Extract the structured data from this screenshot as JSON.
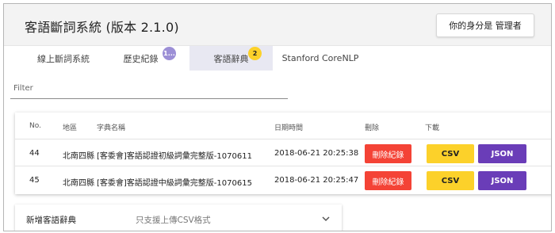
{
  "header": {
    "title": "客語斷詞系統 (版本 2.1.0)",
    "identity_label": "你的身分是 管理者"
  },
  "tabs": [
    {
      "label": "線上斷詞系統",
      "badge": ""
    },
    {
      "label": "歷史紀錄",
      "badge": "1..."
    },
    {
      "label": "客語辭典",
      "badge": "2"
    },
    {
      "label": "Stanford CoreNLP",
      "badge": ""
    }
  ],
  "filter": {
    "placeholder": "Filter",
    "value": ""
  },
  "table": {
    "headers": {
      "no": "No.",
      "region": "地區",
      "dict_name": "字典名稱",
      "datetime": "日期時間",
      "delete": "刪除",
      "download": "下載"
    },
    "rows": [
      {
        "no": "44",
        "region": "北南四縣",
        "dict_name": "[客委會]客語認證初級詞彙完整版-1070611",
        "datetime": "2018-06-21 20:25:38",
        "delete_label": "刪除紀錄",
        "csv_label": "CSV",
        "json_label": "JSON"
      },
      {
        "no": "45",
        "region": "北南四縣",
        "dict_name": "[客委會]客語認證中級詞彙完整版-1070615",
        "datetime": "2018-06-21 20:25:47",
        "delete_label": "刪除紀錄",
        "csv_label": "CSV",
        "json_label": "JSON"
      }
    ]
  },
  "add_dictionary": {
    "title": "新增客語辭典",
    "hint": "只支援上傳CSV格式",
    "icon": "chevron-down-icon"
  },
  "colors": {
    "active_tab_bg": "#e8e8f2",
    "badge_purple": "#9c8fd6",
    "badge_yellow": "#fcd12a",
    "delete_red": "#f44336",
    "csv_yellow": "#fcd12a",
    "json_purple": "#6a3db8"
  }
}
